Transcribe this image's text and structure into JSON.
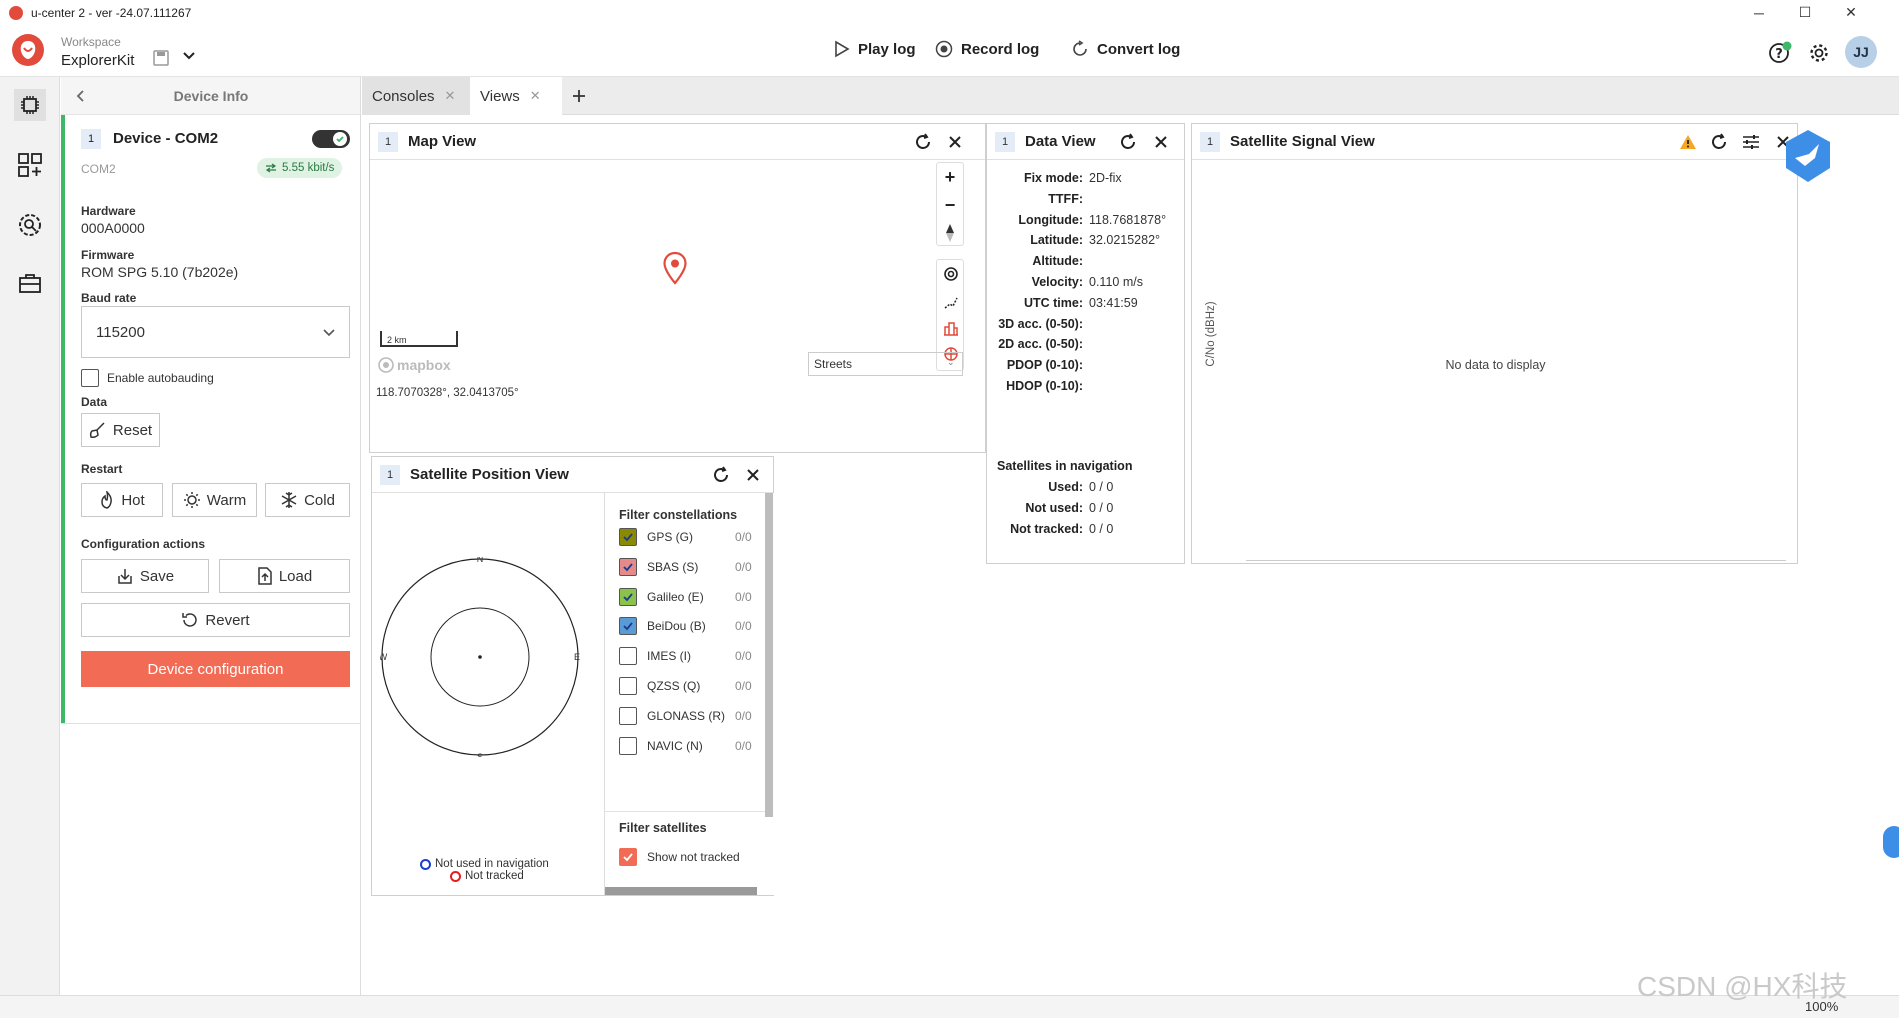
{
  "window": {
    "title": "u-center 2 - ver -24.07.111267"
  },
  "header": {
    "workspace_label": "Workspace",
    "workspace_name": "ExplorerKit",
    "play_log": "Play log",
    "record_log": "Record log",
    "convert_log": "Convert log",
    "avatar": "JJ"
  },
  "device_panel": {
    "title": "Device Info",
    "device_num": "1",
    "device_name": "Device - COM2",
    "port": "COM2",
    "rate": "5.55 kbit/s",
    "hardware_label": "Hardware",
    "hardware_value": "000A0000",
    "firmware_label": "Firmware",
    "firmware_value": "ROM SPG 5.10 (7b202e)",
    "baud_label": "Baud rate",
    "baud_value": "115200",
    "autobaud_label": "Enable autobauding",
    "data_label": "Data",
    "reset_btn": "Reset",
    "restart_label": "Restart",
    "hot_btn": "Hot",
    "warm_btn": "Warm",
    "cold_btn": "Cold",
    "config_label": "Configuration actions",
    "save_btn": "Save",
    "load_btn": "Load",
    "revert_btn": "Revert",
    "device_config_btn": "Device configuration",
    "accent": "#3cb868",
    "primary": "#f26b55"
  },
  "tabs": [
    {
      "label": "Consoles"
    },
    {
      "label": "Views"
    }
  ],
  "map_view": {
    "num": "1",
    "title": "Map View",
    "scale": "2 km",
    "attribution": "mapbox",
    "style": "Streets",
    "coords": "118.7070328°, 32.0413705°"
  },
  "data_view": {
    "num": "1",
    "title": "Data View",
    "rows": [
      {
        "k": "Fix mode:",
        "v": "2D-fix"
      },
      {
        "k": "TTFF:",
        "v": ""
      },
      {
        "k": "Longitude:",
        "v": "118.7681878°"
      },
      {
        "k": "Latitude:",
        "v": "32.0215282°"
      },
      {
        "k": "Altitude:",
        "v": ""
      },
      {
        "k": "Velocity:",
        "v": "0.110 m/s"
      },
      {
        "k": "UTC time:",
        "v": "03:41:59"
      },
      {
        "k": "3D acc. (0-50):",
        "v": ""
      },
      {
        "k": "2D acc. (0-50):",
        "v": ""
      },
      {
        "k": "PDOP (0-10):",
        "v": ""
      },
      {
        "k": "HDOP (0-10):",
        "v": ""
      }
    ],
    "sats_title": "Satellites in navigation",
    "sat_rows": [
      {
        "k": "Used:",
        "v": "0 / 0"
      },
      {
        "k": "Not used:",
        "v": "0 / 0"
      },
      {
        "k": "Not tracked:",
        "v": "0 / 0"
      }
    ]
  },
  "signal_view": {
    "num": "1",
    "title": "Satellite Signal View",
    "y_axis": "C/No (dBHz)",
    "empty": "No data to display"
  },
  "position_view": {
    "num": "1",
    "title": "Satellite Position View",
    "compass": {
      "n": "N",
      "e": "E",
      "s": "S",
      "w": "W"
    },
    "legend_not_used": "Not used in navigation",
    "legend_not_tracked": "Not tracked",
    "filter_constellations": "Filter constellations",
    "constellations": [
      {
        "label": "GPS (G)",
        "count": "0/0",
        "checked": true,
        "color": "#8a8a00"
      },
      {
        "label": "SBAS (S)",
        "count": "0/0",
        "checked": true,
        "color": "#e48a8a"
      },
      {
        "label": "Galileo (E)",
        "count": "0/0",
        "checked": true,
        "color": "#8bc34a"
      },
      {
        "label": "BeiDou (B)",
        "count": "0/0",
        "checked": true,
        "color": "#5b9bd5"
      },
      {
        "label": "IMES (I)",
        "count": "0/0",
        "checked": false,
        "color": "#ffffff"
      },
      {
        "label": "QZSS (Q)",
        "count": "0/0",
        "checked": false,
        "color": "#ffffff"
      },
      {
        "label": "GLONASS (R)",
        "count": "0/0",
        "checked": false,
        "color": "#ffffff"
      },
      {
        "label": "NAVIC (N)",
        "count": "0/0",
        "checked": false,
        "color": "#ffffff"
      }
    ],
    "filter_satellites": "Filter satellites",
    "show_not_tracked": "Show not tracked"
  },
  "status": {
    "zoom": "100%",
    "watermark": "CSDN @HX科技"
  }
}
